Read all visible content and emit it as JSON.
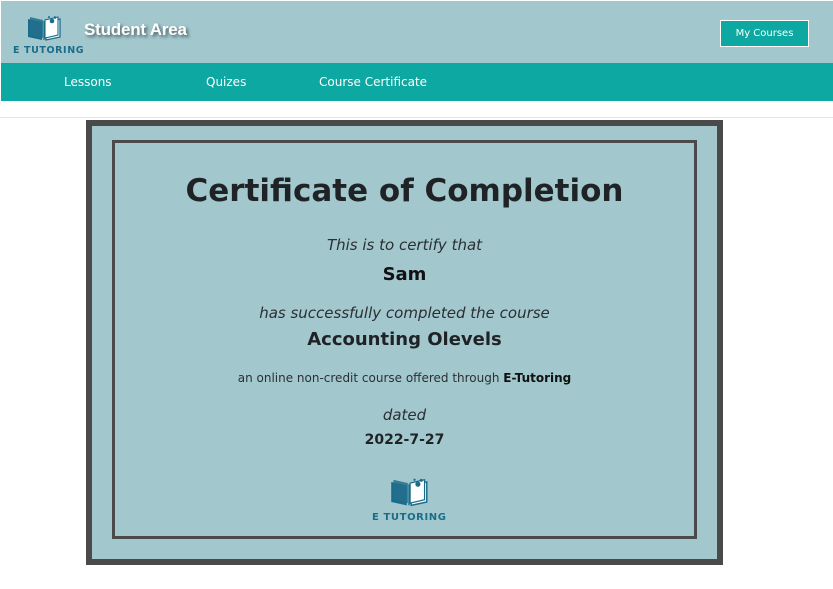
{
  "header": {
    "logo_text": "E TUTORING",
    "title": "Student Area",
    "my_courses_label": "My Courses",
    "background_color": "#a2c8ce",
    "button_color": "#0ca8a1"
  },
  "nav": {
    "background_color": "#0ca8a1",
    "items": [
      {
        "label": "Lessons"
      },
      {
        "label": "Quizes"
      },
      {
        "label": "Course Certificate"
      }
    ]
  },
  "certificate": {
    "title": "Certificate of Completion",
    "certify_text": "This is to certify that",
    "student_name": "Sam",
    "completed_text": "has successfully completed the course",
    "course_name": "Accounting Olevels",
    "offered_text": "an online non-credit course offered through",
    "offered_by": "E-Tutoring",
    "dated_label": "dated",
    "date": "2022-7-27",
    "logo_text": "E TUTORING",
    "background_color": "#a2c8ce",
    "border_color": "#4a4a4a"
  },
  "icons": {
    "logo": "open-book-icon"
  }
}
